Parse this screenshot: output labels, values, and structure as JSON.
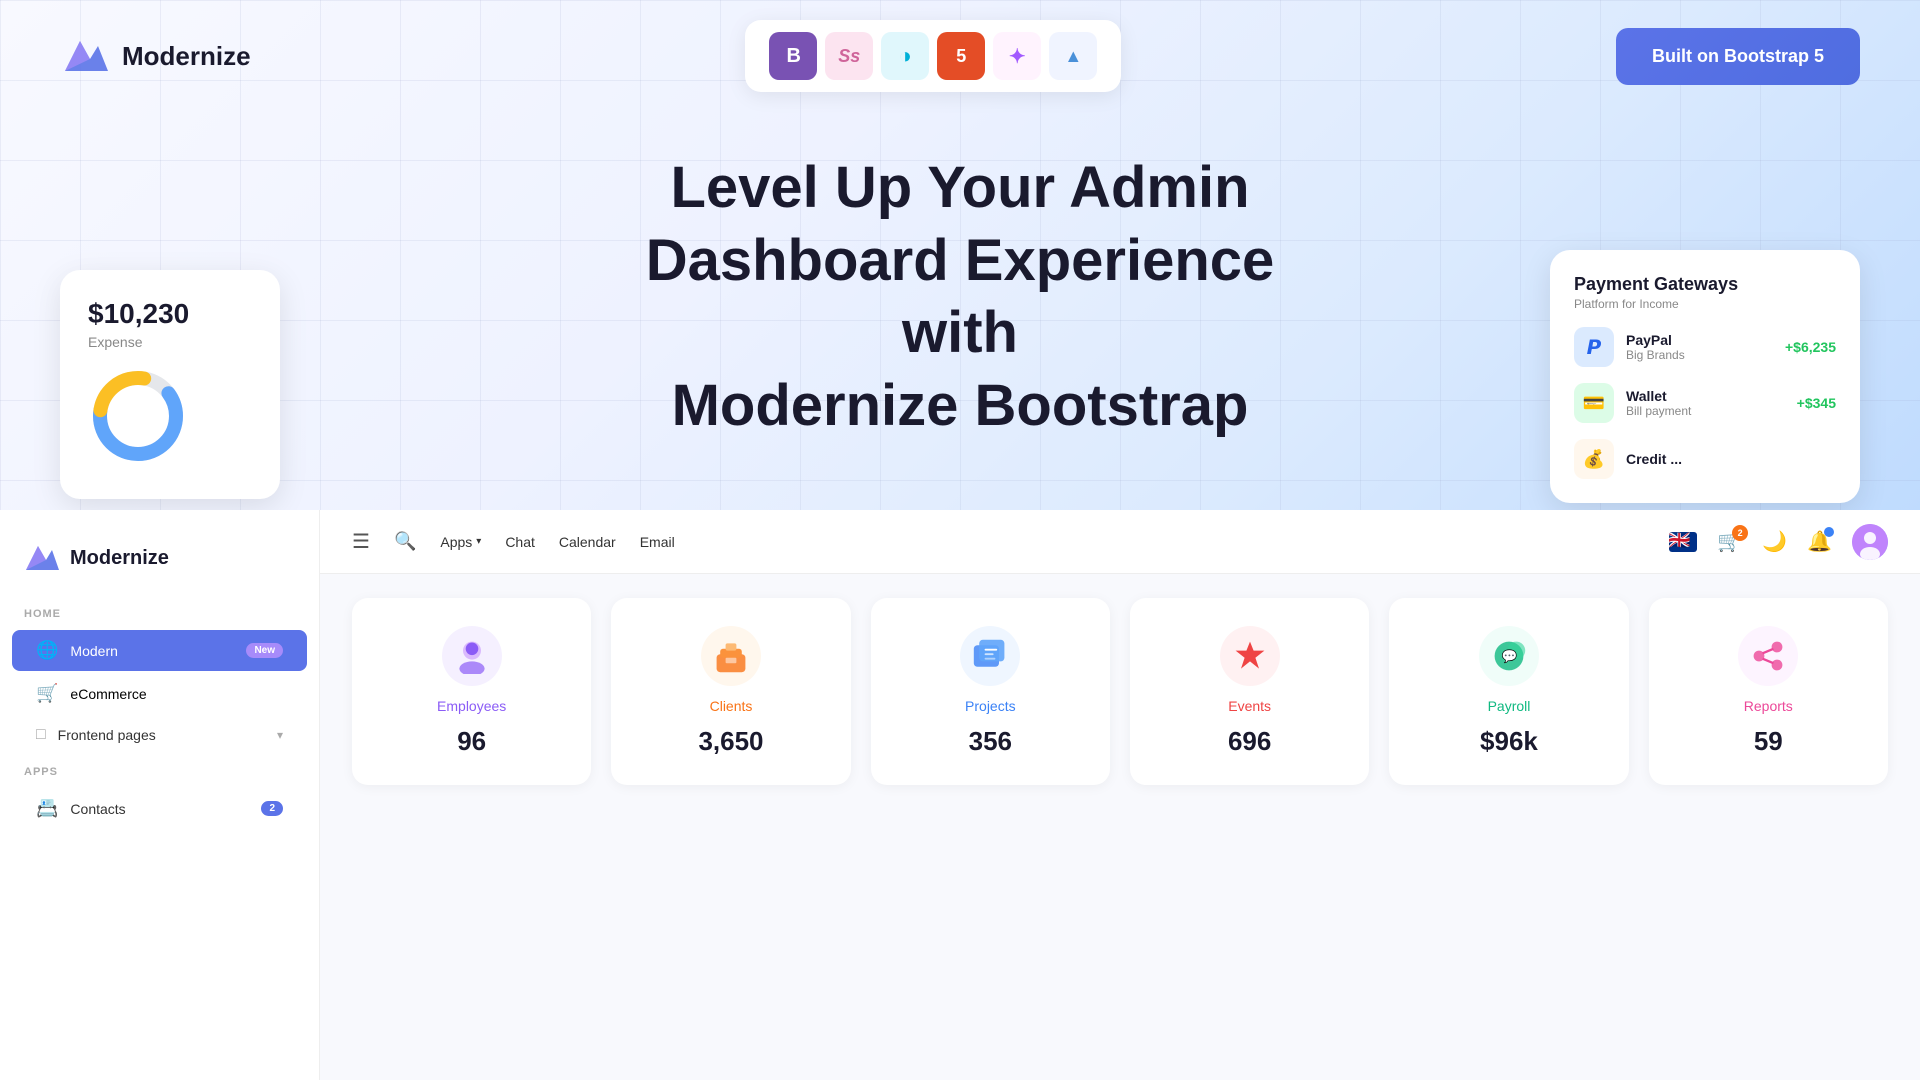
{
  "hero": {
    "logo_text": "Modernize",
    "cta_button": "Built on Bootstrap 5",
    "title_line1": "Level Up Your Admin",
    "title_line2": "Dashboard Experience with",
    "title_line3": "Modernize Bootstrap"
  },
  "tech_icons": [
    {
      "name": "bootstrap-icon",
      "symbol": "B",
      "color": "#7952b3",
      "bg": "#7952b3"
    },
    {
      "name": "sass-icon",
      "symbol": "S",
      "color": "#cf649a",
      "bg": "#fff"
    },
    {
      "name": "css-icon",
      "symbol": "◑",
      "color": "#00b0d7",
      "bg": "#fff"
    },
    {
      "name": "html5-icon",
      "symbol": "5",
      "color": "#e44d26",
      "bg": "#e44d26"
    },
    {
      "name": "figma-icon",
      "symbol": "✦",
      "color": "#a259ff",
      "bg": "#fff"
    },
    {
      "name": "aws-icon",
      "symbol": "▲",
      "color": "#4a90d9",
      "bg": "#fff"
    }
  ],
  "expense_card": {
    "amount": "$10,230",
    "label": "Expense"
  },
  "payment_gateways": {
    "title": "Payment Gateways",
    "subtitle": "Platform for Income",
    "items": [
      {
        "name": "PayPal",
        "sub": "Big Brands",
        "amount": "+$6,235",
        "icon": "💳",
        "bg": "#eff6ff"
      },
      {
        "name": "Wallet",
        "sub": "Bill payment",
        "amount": "+$345",
        "icon": "👛",
        "bg": "#f0fdf4"
      },
      {
        "name": "Credit ...",
        "sub": "",
        "amount": "",
        "icon": "💰",
        "bg": "#fff7ed"
      }
    ]
  },
  "sidebar": {
    "logo_text": "Modernize",
    "sections": [
      {
        "label": "HOME",
        "items": [
          {
            "id": "modern",
            "label": "Modern",
            "badge": "New",
            "active": true,
            "icon": "🌐"
          },
          {
            "id": "ecommerce",
            "label": "eCommerce",
            "active": false,
            "icon": "🛒"
          },
          {
            "id": "frontend",
            "label": "Frontend pages",
            "active": false,
            "icon": "□",
            "hasChevron": true
          }
        ]
      },
      {
        "label": "APPS",
        "items": [
          {
            "id": "contacts",
            "label": "Contacts",
            "active": false,
            "icon": "📇"
          }
        ]
      }
    ]
  },
  "navbar": {
    "menu_label": "☰",
    "search_label": "🔍",
    "links": [
      {
        "label": "Apps",
        "hasChevron": true
      },
      {
        "label": "Chat"
      },
      {
        "label": "Calendar"
      },
      {
        "label": "Email"
      }
    ],
    "cart_badge": "2",
    "notification_dot": true
  },
  "stat_cards": [
    {
      "id": "employees",
      "label": "Employees",
      "value": "96",
      "icon_emoji": "👤",
      "bg_class": "card-bg-purple",
      "label_color": "#8b5cf6"
    },
    {
      "id": "clients",
      "label": "Clients",
      "value": "3,650",
      "icon_emoji": "💼",
      "bg_class": "card-bg-orange",
      "label_color": "#f97316"
    },
    {
      "id": "projects",
      "label": "Projects",
      "value": "356",
      "icon_emoji": "📋",
      "bg_class": "card-bg-blue",
      "label_color": "#3b82f6"
    },
    {
      "id": "events",
      "label": "Events",
      "value": "696",
      "icon_emoji": "⭐",
      "bg_class": "card-bg-red",
      "label_color": "#ef4444"
    },
    {
      "id": "payroll",
      "label": "Payroll",
      "value": "$96k",
      "icon_emoji": "💬",
      "bg_class": "card-bg-green",
      "label_color": "#10b981"
    },
    {
      "id": "reports",
      "label": "Reports",
      "value": "59",
      "icon_emoji": "↗",
      "bg_class": "card-bg-pink",
      "label_color": "#ec4899"
    }
  ]
}
